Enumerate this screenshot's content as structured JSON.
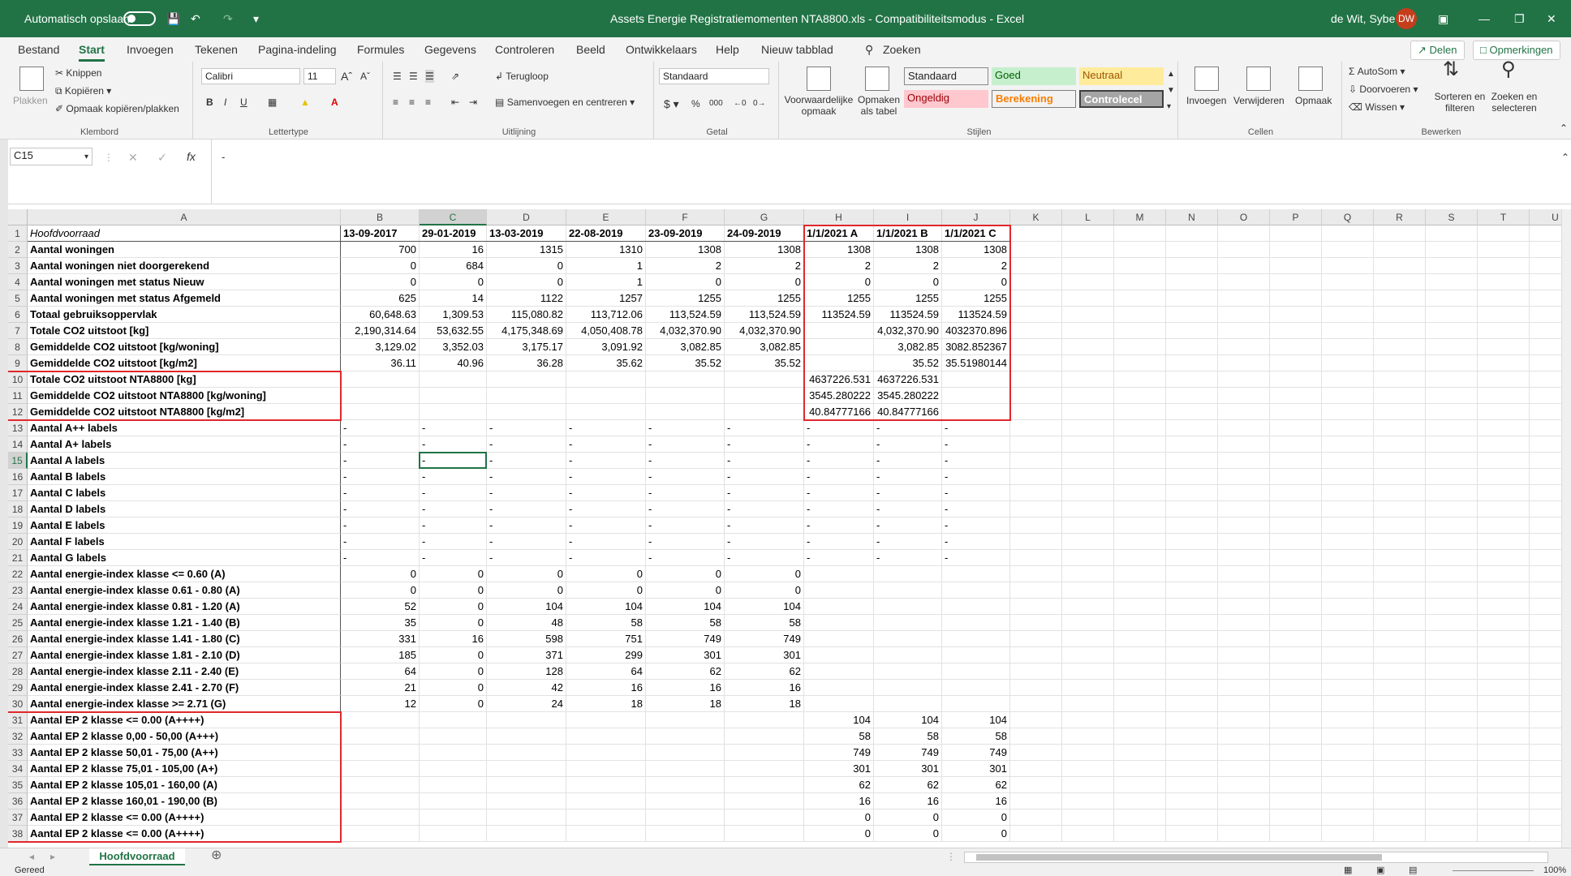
{
  "titlebar": {
    "autosave_label": "Automatisch opslaan",
    "title": "Assets Energie Registratiemomenten NTA8800.xls - Compatibiliteitsmodus - Excel",
    "user": "de Wit, Sybe",
    "initials": "DW",
    "accent": "#217346"
  },
  "tabs": [
    "Bestand",
    "Start",
    "Invoegen",
    "Tekenen",
    "Pagina-indeling",
    "Formules",
    "Gegevens",
    "Controleren",
    "Beeld",
    "Ontwikkelaars",
    "Help",
    "Nieuw tabblad"
  ],
  "tell_me": "Zoeken",
  "share_label": "Delen",
  "comments_label": "Opmerkingen",
  "ribbon": {
    "clipboard": {
      "label": "Klembord",
      "paste": "Plakken",
      "cut": "Knippen",
      "copy": "Kopiëren",
      "painter": "Opmaak kopiëren/plakken"
    },
    "font": {
      "label": "Lettertype",
      "name": "Calibri",
      "size": "11"
    },
    "alignment": {
      "label": "Uitlijning",
      "wrap": "Terugloop",
      "merge": "Samenvoegen en centreren"
    },
    "number": {
      "label": "Getal",
      "format": "Standaard"
    },
    "styles": {
      "label": "Stijlen",
      "conditional": "Voorwaardelijke opmaak",
      "as_table": "Opmaken als tabel",
      "cells": [
        {
          "name": "Standaard",
          "bg": "#ffffff",
          "fg": "#000000"
        },
        {
          "name": "Goed",
          "bg": "#c6efce",
          "fg": "#006100"
        },
        {
          "name": "Neutraal",
          "bg": "#ffeb9c",
          "fg": "#9c5700"
        },
        {
          "name": "Ongeldig",
          "bg": "#ffc7ce",
          "fg": "#9c0006"
        },
        {
          "name": "Berekening",
          "bg": "#f2f2f2",
          "fg": "#fa7d00"
        },
        {
          "name": "Controlecel",
          "bg": "#a5a5a5",
          "fg": "#ffffff"
        }
      ]
    },
    "cells": {
      "label": "Cellen",
      "insert": "Invoegen",
      "delete": "Verwijderen",
      "format": "Opmaak"
    },
    "editing": {
      "label": "Bewerken",
      "autosum": "AutoSom",
      "fill": "Doorvoeren",
      "clear": "Wissen",
      "sort": "Sorteren en filteren",
      "find": "Zoeken en selecteren"
    }
  },
  "formula_bar": {
    "name_box": "C15",
    "formula": "-"
  },
  "grid": {
    "columns": [
      "A",
      "B",
      "C",
      "D",
      "E",
      "F",
      "G",
      "H",
      "I",
      "J",
      "K",
      "L",
      "M",
      "N",
      "O",
      "P",
      "Q",
      "R",
      "S",
      "T",
      "U"
    ],
    "selected_col": "C",
    "selected_row": 15,
    "header_row": [
      "Hoofdvoorraad",
      "13-09-2017",
      "29-01-2019",
      "13-03-2019",
      "22-08-2019",
      "23-09-2019",
      "24-09-2019",
      "1/1/2021 A",
      "1/1/2021 B",
      "1/1/2021 C"
    ],
    "rows": [
      [
        "Aantal woningen",
        "700",
        "16",
        "1315",
        "1310",
        "1308",
        "1308",
        "1308",
        "1308",
        "1308"
      ],
      [
        "Aantal woningen niet doorgerekend",
        "0",
        "684",
        "0",
        "1",
        "2",
        "2",
        "2",
        "2",
        "2"
      ],
      [
        "Aantal woningen met status Nieuw",
        "0",
        "0",
        "0",
        "1",
        "0",
        "0",
        "0",
        "0",
        "0"
      ],
      [
        "Aantal woningen met status Afgemeld",
        "625",
        "14",
        "1122",
        "1257",
        "1255",
        "1255",
        "1255",
        "1255",
        "1255"
      ],
      [
        "Totaal gebruiksoppervlak",
        "60,648.63",
        "1,309.53",
        "115,080.82",
        "113,712.06",
        "113,524.59",
        "113,524.59",
        "113524.59",
        "113524.59",
        "113524.59"
      ],
      [
        "Totale CO2 uitstoot [kg]",
        "2,190,314.64",
        "53,632.55",
        "4,175,348.69",
        "4,050,408.78",
        "4,032,370.90",
        "4,032,370.90",
        "",
        "4,032,370.90",
        "4032370.896"
      ],
      [
        "Gemiddelde CO2 uitstoot [kg/woning]",
        "3,129.02",
        "3,352.03",
        "3,175.17",
        "3,091.92",
        "3,082.85",
        "3,082.85",
        "",
        "3,082.85",
        "3082.852367"
      ],
      [
        "Gemiddelde CO2 uitstoot [kg/m2]",
        "36.11",
        "40.96",
        "36.28",
        "35.62",
        "35.52",
        "35.52",
        "",
        "35.52",
        "35.51980144"
      ],
      [
        "Totale CO2 uitstoot NTA8800 [kg]",
        "",
        "",
        "",
        "",
        "",
        "",
        "4637226.531",
        "4637226.531",
        ""
      ],
      [
        "Gemiddelde CO2 uitstoot NTA8800 [kg/woning]",
        "",
        "",
        "",
        "",
        "",
        "",
        "3545.280222",
        "3545.280222",
        ""
      ],
      [
        "Gemiddelde CO2 uitstoot NTA8800 [kg/m2]",
        "",
        "",
        "",
        "",
        "",
        "",
        "40.84777166",
        "40.84777166",
        ""
      ],
      [
        "Aantal A++ labels",
        "-",
        "-",
        "-",
        "-",
        "-",
        "-",
        "-",
        "-",
        "-"
      ],
      [
        "Aantal A+ labels",
        "-",
        "-",
        "-",
        "-",
        "-",
        "-",
        "-",
        "-",
        "-"
      ],
      [
        "Aantal A labels",
        "-",
        "-",
        "-",
        "-",
        "-",
        "-",
        "-",
        "-",
        "-"
      ],
      [
        "Aantal B labels",
        "-",
        "-",
        "-",
        "-",
        "-",
        "-",
        "-",
        "-",
        "-"
      ],
      [
        "Aantal C labels",
        "-",
        "-",
        "-",
        "-",
        "-",
        "-",
        "-",
        "-",
        "-"
      ],
      [
        "Aantal D labels",
        "-",
        "-",
        "-",
        "-",
        "-",
        "-",
        "-",
        "-",
        "-"
      ],
      [
        "Aantal E labels",
        "-",
        "-",
        "-",
        "-",
        "-",
        "-",
        "-",
        "-",
        "-"
      ],
      [
        "Aantal F labels",
        "-",
        "-",
        "-",
        "-",
        "-",
        "-",
        "-",
        "-",
        "-"
      ],
      [
        "Aantal G labels",
        "-",
        "-",
        "-",
        "-",
        "-",
        "-",
        "-",
        "-",
        "-"
      ],
      [
        "Aantal energie-index klasse <= 0.60 (A)",
        "0",
        "0",
        "0",
        "0",
        "0",
        "0",
        "",
        "",
        ""
      ],
      [
        "Aantal energie-index klasse 0.61 - 0.80 (A)",
        "0",
        "0",
        "0",
        "0",
        "0",
        "0",
        "",
        "",
        ""
      ],
      [
        "Aantal energie-index klasse 0.81 - 1.20 (A)",
        "52",
        "0",
        "104",
        "104",
        "104",
        "104",
        "",
        "",
        ""
      ],
      [
        "Aantal energie-index klasse 1.21 - 1.40 (B)",
        "35",
        "0",
        "48",
        "58",
        "58",
        "58",
        "",
        "",
        ""
      ],
      [
        "Aantal energie-index klasse 1.41 - 1.80 (C)",
        "331",
        "16",
        "598",
        "751",
        "749",
        "749",
        "",
        "",
        ""
      ],
      [
        "Aantal energie-index klasse 1.81 - 2.10 (D)",
        "185",
        "0",
        "371",
        "299",
        "301",
        "301",
        "",
        "",
        ""
      ],
      [
        "Aantal energie-index klasse 2.11 - 2.40 (E)",
        "64",
        "0",
        "128",
        "64",
        "62",
        "62",
        "",
        "",
        ""
      ],
      [
        "Aantal energie-index klasse 2.41 - 2.70 (F)",
        "21",
        "0",
        "42",
        "16",
        "16",
        "16",
        "",
        "",
        ""
      ],
      [
        "Aantal energie-index klasse >= 2.71 (G)",
        "12",
        "0",
        "24",
        "18",
        "18",
        "18",
        "",
        "",
        ""
      ],
      [
        "Aantal EP 2 klasse <= 0.00 (A++++)",
        "",
        "",
        "",
        "",
        "",
        "",
        "104",
        "104",
        "104"
      ],
      [
        "Aantal EP 2 klasse 0,00 - 50,00  (A+++)",
        "",
        "",
        "",
        "",
        "",
        "",
        "58",
        "58",
        "58"
      ],
      [
        "Aantal EP 2 klasse 50,01 - 75,00 (A++)",
        "",
        "",
        "",
        "",
        "",
        "",
        "749",
        "749",
        "749"
      ],
      [
        "Aantal EP 2 klasse 75,01 - 105,00 (A+)",
        "",
        "",
        "",
        "",
        "",
        "",
        "301",
        "301",
        "301"
      ],
      [
        "Aantal EP 2 klasse 105,01 - 160,00 (A)",
        "",
        "",
        "",
        "",
        "",
        "",
        "62",
        "62",
        "62"
      ],
      [
        "Aantal EP 2 klasse 160,01 - 190,00 (B)",
        "",
        "",
        "",
        "",
        "",
        "",
        "16",
        "16",
        "16"
      ],
      [
        "Aantal EP 2 klasse <= 0.00 (A++++)",
        "",
        "",
        "",
        "",
        "",
        "",
        "0",
        "0",
        "0"
      ],
      [
        "Aantal EP 2 klasse <= 0.00 (A++++)",
        "",
        "",
        "",
        "",
        "",
        "",
        "0",
        "0",
        "0"
      ]
    ]
  },
  "sheet_tab": "Hoofdvoorraad",
  "status": {
    "ready": "Gereed",
    "zoom": "100%"
  },
  "highlight_color": "#e0282b"
}
